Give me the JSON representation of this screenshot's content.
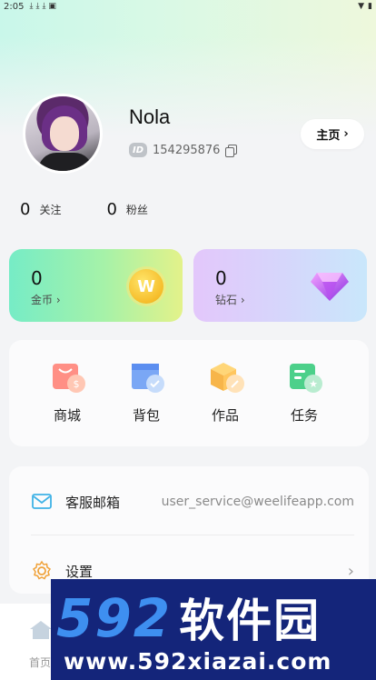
{
  "status_bar": {
    "time": "2:05"
  },
  "profile": {
    "username": "Nola",
    "id_badge": "ID",
    "user_id": "154295876",
    "home_button_label": "主页"
  },
  "stats": {
    "following_count": "0",
    "following_label": "关注",
    "fans_count": "0",
    "fans_label": "粉丝"
  },
  "wallet": {
    "coins": {
      "value": "0",
      "label": "金币",
      "icon_text": "W"
    },
    "diamonds": {
      "value": "0",
      "label": "钻石"
    }
  },
  "tools": [
    {
      "label": "商城",
      "icon": "shopping-bag-icon"
    },
    {
      "label": "背包",
      "icon": "backpack-icon"
    },
    {
      "label": "作品",
      "icon": "works-box-icon"
    },
    {
      "label": "任务",
      "icon": "task-icon"
    }
  ],
  "menu": {
    "email_label": "客服邮箱",
    "email_value": "user_service@weelifeapp.com",
    "settings_label": "设置"
  },
  "bottom_nav": {
    "home_label": "首页"
  },
  "watermark": {
    "number": "592",
    "name": "软件园",
    "url": "www.592xiazai.com"
  },
  "colors": {
    "coin_card_start": "#76ecc6",
    "coin_card_end": "#e3f28a",
    "diamond_card_start": "#e3c7fb",
    "diamond_card_end": "#c9e7fb",
    "watermark_bg": "#14257a",
    "watermark_blue": "#3e8ff0"
  }
}
